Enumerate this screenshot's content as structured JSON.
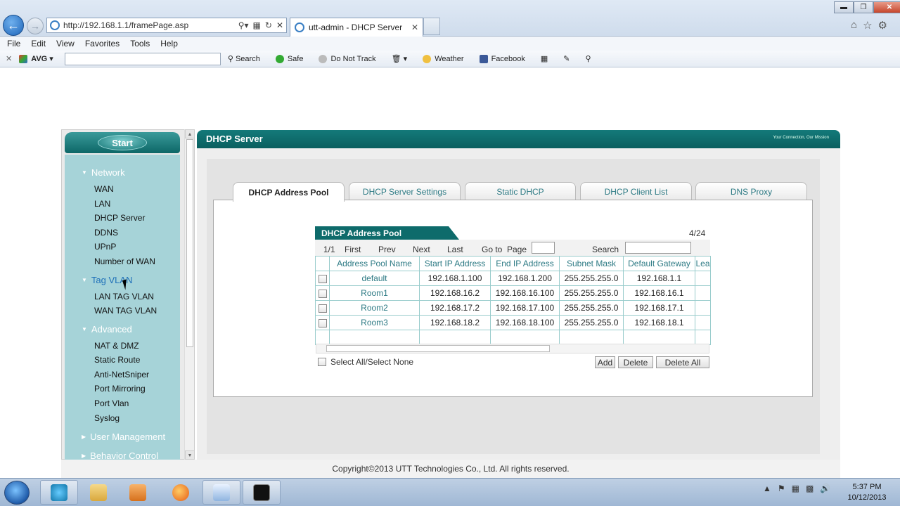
{
  "browser": {
    "url": "http://192.168.1.1/framePage.asp",
    "tab_title": "utt-admin - DHCP Server",
    "menu": [
      "File",
      "Edit",
      "View",
      "Favorites",
      "Tools",
      "Help"
    ],
    "avg": {
      "brand": "AVG",
      "search": "Search",
      "safe": "Safe",
      "dnt": "Do Not Track",
      "weather": "Weather",
      "facebook": "Facebook"
    }
  },
  "sidebar": {
    "start": "Start",
    "sections": [
      {
        "label": "Network",
        "items": [
          "WAN",
          "LAN",
          "DHCP Server",
          "DDNS",
          "UPnP",
          "Number of WAN"
        ]
      },
      {
        "label": "Tag VLAN",
        "items": [
          "LAN TAG VLAN",
          "WAN TAG VLAN"
        ]
      },
      {
        "label": "Advanced",
        "items": [
          "NAT & DMZ",
          "Static Route",
          "Anti-NetSniper",
          "Port Mirroring",
          "Port Vlan",
          "Syslog"
        ]
      },
      {
        "label": "User Management",
        "items": []
      },
      {
        "label": "Behavior Control",
        "items": []
      }
    ]
  },
  "page": {
    "title": "DHCP Server",
    "brand": "Your Connection, Our Mission",
    "tabs": [
      "DHCP Address Pool",
      "DHCP Server Settings",
      "Static DHCP",
      "DHCP Client List",
      "DNS Proxy"
    ],
    "pool_title": "DHCP Address Pool",
    "page_count": "4/24",
    "pager": {
      "pos": "1/1",
      "first": "First",
      "prev": "Prev",
      "next": "Next",
      "last": "Last",
      "goto": "Go to",
      "page": "Page",
      "search": "Search"
    },
    "columns": [
      "Address Pool Name",
      "Start IP Address",
      "End IP Address",
      "Subnet Mask",
      "Default Gateway",
      "Lea"
    ],
    "rows": [
      [
        "default",
        "192.168.1.100",
        "192.168.1.200",
        "255.255.255.0",
        "192.168.1.1"
      ],
      [
        "Room1",
        "192.168.16.2",
        "192.168.16.100",
        "255.255.255.0",
        "192.168.16.1"
      ],
      [
        "Room2",
        "192.168.17.2",
        "192.168.17.100",
        "255.255.255.0",
        "192.168.17.1"
      ],
      [
        "Room3",
        "192.168.18.2",
        "192.168.18.100",
        "255.255.255.0",
        "192.168.18.1"
      ]
    ],
    "select_all": "Select All/Select None",
    "buttons": {
      "add": "Add",
      "delete": "Delete",
      "delete_all": "Delete All"
    },
    "footer": "Copyright©2013 UTT Technologies Co., Ltd. All rights reserved."
  },
  "taskbar": {
    "time": "5:37 PM",
    "date": "10/12/2013"
  }
}
